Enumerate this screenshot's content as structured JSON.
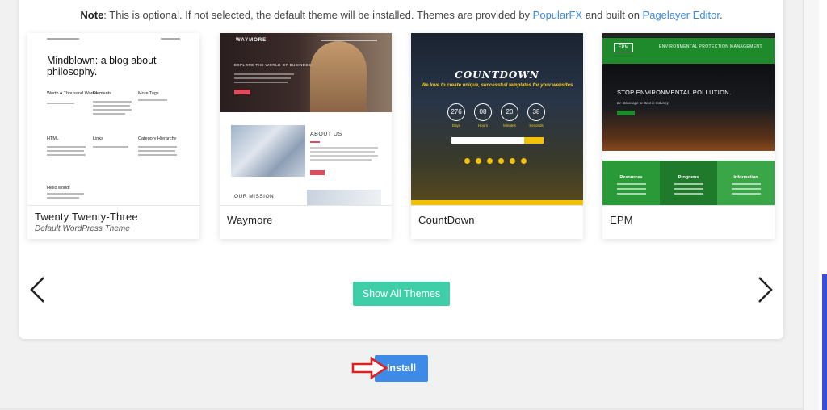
{
  "note": {
    "label": "Note",
    "text_1": ": This is optional. If not selected, the default theme will be installed. Themes are provided by ",
    "link_1": "PopularFX",
    "text_2": " and built on ",
    "link_2": "Pagelayer Editor",
    "text_3": "."
  },
  "themes": [
    {
      "name": "Twenty Twenty-Three",
      "subtitle": "Default WordPress Theme",
      "thumb": {
        "headline": "Mindblown: a blog about philosophy.",
        "posts": [
          "Worth A Thousand Words",
          "Elements",
          "More Tags",
          "HTML",
          "Links",
          "Category Hierarchy",
          "Hello world!"
        ]
      }
    },
    {
      "name": "Waymore",
      "subtitle": "",
      "thumb": {
        "logo": "WAYMORE",
        "headline": "EXPLORE THE WORLD OF BUSINESS",
        "about": "ABOUT US",
        "mission": "OUR MISSION"
      }
    },
    {
      "name": "CountDown",
      "subtitle": "",
      "thumb": {
        "title": "COUNTDOWN",
        "tagline": "We love to create unique, successfull templates for your websites",
        "timer": [
          {
            "value": "276",
            "label": "Days"
          },
          {
            "value": "08",
            "label": "Hours"
          },
          {
            "value": "20",
            "label": "Minutes"
          },
          {
            "value": "38",
            "label": "Seconds"
          }
        ]
      }
    },
    {
      "name": "EPM",
      "subtitle": "",
      "thumb": {
        "logo": "EPM",
        "header_title": "ENVIRONMENTAL PROTECTION MANAGEMENT",
        "hero_title": "STOP ENVIRONMENTAL POLLUTION.",
        "hero_sub": "Dr. Coverage to Best in Industry",
        "blocks": [
          "Resources",
          "Programs",
          "Information"
        ]
      }
    }
  ],
  "carousel": {
    "prev_icon": "chevron-left-icon",
    "next_icon": "chevron-right-icon"
  },
  "show_all_label": "Show All Themes",
  "install_label": "Install",
  "colors": {
    "link": "#3d8be6",
    "show_all": "#3ecfa9",
    "install": "#3d8be6",
    "annotation_arrow": "#e02020"
  }
}
